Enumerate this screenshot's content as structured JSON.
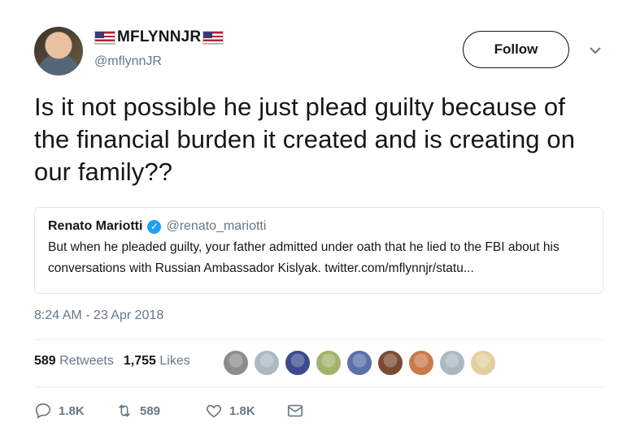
{
  "author": {
    "display_name": "MFLYNNJR",
    "handle": "@mflynnJR",
    "flag_icon": "us-flag-icon"
  },
  "follow_button": {
    "label": "Follow"
  },
  "tweet": {
    "text": "Is it not possible he just plead guilty because of the financial burden it created and is creating on our family??",
    "timestamp": "8:24 AM - 23 Apr 2018"
  },
  "quoted_tweet": {
    "name": "Renato Mariotti",
    "handle": "@renato_mariotti",
    "verified_icon": "verified-badge-icon",
    "text": "But when he pleaded guilty, your father admitted under oath that he lied to the FBI about his conversations with Russian Ambassador Kislyak. twitter.com/mflynnjr/statu..."
  },
  "stats": {
    "retweets_count": "589",
    "retweets_label": "Retweets",
    "likes_count": "1,755",
    "likes_label": "Likes"
  },
  "likers": [
    {
      "color": "#8a8f8d"
    },
    {
      "color": "#aab8c2"
    },
    {
      "color": "#3b4a8c"
    },
    {
      "color": "#a2b36b"
    },
    {
      "color": "#5b6fa8"
    },
    {
      "color": "#7a4b33"
    },
    {
      "color": "#c97b4a"
    },
    {
      "color": "#aab8c2"
    },
    {
      "color": "#e3cfa0"
    }
  ],
  "actions": {
    "reply_count": "1.8K",
    "retweet_count": "589",
    "like_count": "1.8K"
  },
  "colors": {
    "text": "#14171a",
    "secondary": "#657786",
    "verified": "#1da1f2",
    "border": "#e1e8ed"
  }
}
